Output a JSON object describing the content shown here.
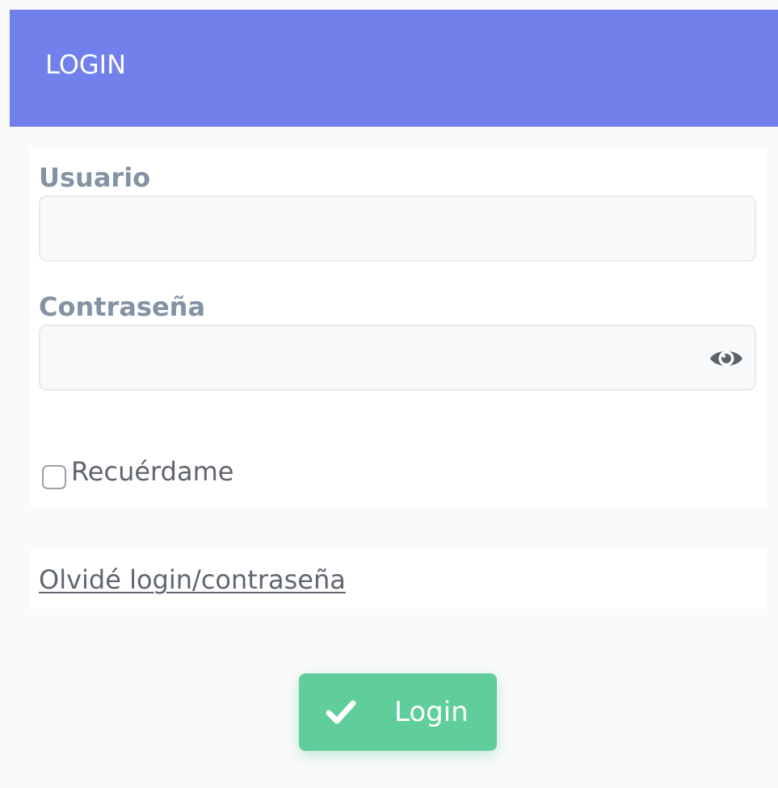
{
  "header": {
    "title": "LOGIN",
    "background_color": "#7280ec"
  },
  "form": {
    "username": {
      "label": "Usuario",
      "value": "",
      "placeholder": ""
    },
    "password": {
      "label": "Contraseña",
      "value": "",
      "placeholder": "",
      "toggle_icon": "eye-icon"
    },
    "remember": {
      "label": "Recuérdame",
      "checked": false
    }
  },
  "links": {
    "forgot_label": "Olvidé login/contraseña"
  },
  "actions": {
    "login_label": "Login",
    "login_icon": "check-icon",
    "login_color": "#5fce9b"
  }
}
